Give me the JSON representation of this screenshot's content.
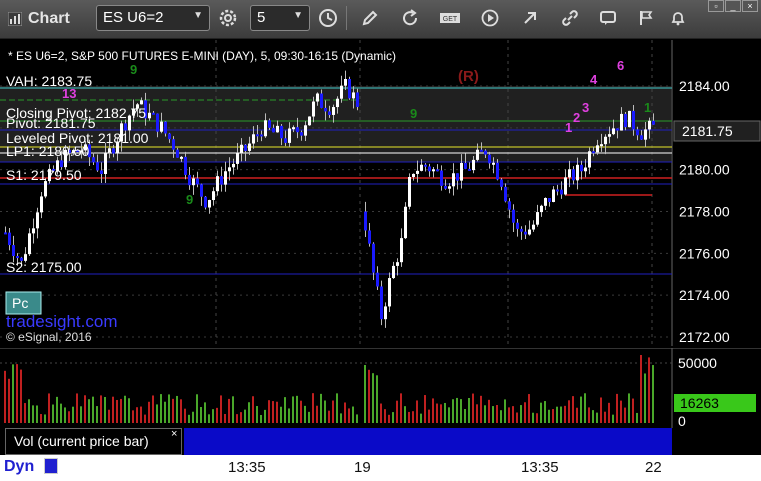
{
  "window": {
    "title": "Chart",
    "symbol_value": "ES U6=2",
    "interval_value": "5"
  },
  "chart_header": "* ES U6=2, S&P 500 FUTURES E-MINI (DAY), 5, 09:30-16:15 (Dynamic)",
  "annotation_r": "(R)",
  "levels": {
    "vah": "VAH: 2183.75",
    "closing_pivot": "Closing Pivot: 2182.75",
    "pivot": "Pivot: 2181.75",
    "leveled_pivot": "Leveled Pivot: 2181.00",
    "lp1": "LP1: 2180.50",
    "s1": "S1: 2179.50",
    "s2": "S2: 2175.00"
  },
  "watermark": {
    "brand": "tradesight.com",
    "copyright": "© eSignal, 2016",
    "pc_badge": "Pc"
  },
  "price_axis": {
    "ticks": [
      "2184.00",
      "2182.00",
      "2180.00",
      "2178.00",
      "2176.00",
      "2174.00",
      "2172.00"
    ],
    "current_price": "2181.75"
  },
  "volume_axis": {
    "ticks": [
      "50000",
      "0"
    ],
    "current_volume": "16263"
  },
  "volume_study_label": "Vol (current price bar)",
  "close_glyph": "×",
  "time_axis": {
    "dyn_label": "Dyn",
    "labels": [
      "13:35",
      "19",
      "13:35",
      "22"
    ]
  },
  "markers": {
    "setup_counts_magenta": [
      "13",
      "1",
      "2",
      "3",
      "4",
      "6"
    ],
    "setup_counts_green": [
      "9",
      "9",
      "9",
      "1"
    ]
  },
  "colors": {
    "up_bar": "#ffffff",
    "down_bar": "#1a1aff",
    "vah_line": "#40c8c8",
    "closing_pivot_line": "#2a9a2a",
    "pivot_line": "#ffffff",
    "leveled_pivot_line": "#e8e82a",
    "s1_line": "#d02020",
    "s2_line": "#2020c0",
    "volume_up": "#4aa82a",
    "volume_down": "#c02020",
    "current_price_tag": "#202020",
    "current_volume_tag": "#39c81a"
  },
  "chart_data": {
    "type": "candlestick",
    "price_range": [
      2172,
      2185
    ],
    "sessions": [
      "19",
      "22"
    ]
  }
}
